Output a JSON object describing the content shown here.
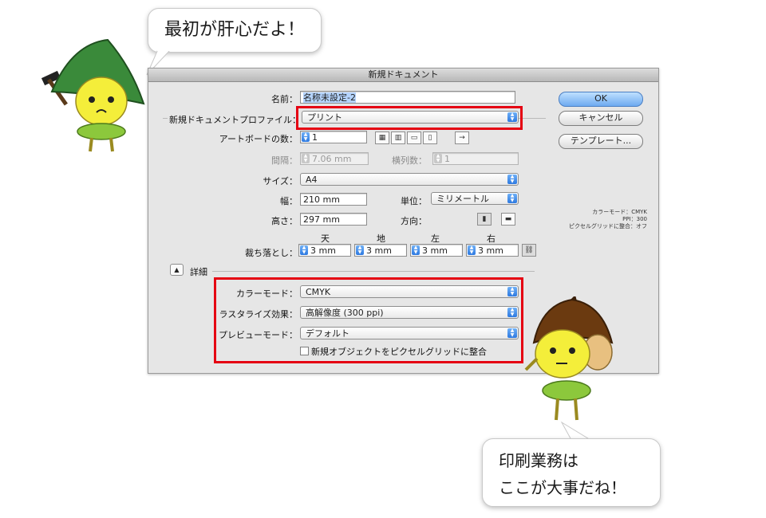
{
  "bubble_top": "最初が肝心だよ！",
  "bubble_bottom": [
    "印刷業務は",
    "ここが大事だね！"
  ],
  "dialog": {
    "title": "新規ドキュメント",
    "name_label": "名前：",
    "name_value": "名称未設定-2",
    "profile_label": "新規ドキュメントプロファイル：",
    "profile_value": "プリント",
    "artboards_label": "アートボードの数：",
    "artboards_value": "1",
    "spacing_label": "間隔：",
    "spacing_value": "7.06 mm",
    "columns_label": "横列数：",
    "columns_value": "1",
    "size_label": "サイズ：",
    "size_value": "A4",
    "width_label": "幅：",
    "width_value": "210 mm",
    "units_label": "単位：",
    "units_value": "ミリメートル",
    "height_label": "高さ：",
    "height_value": "297 mm",
    "orientation_label": "方向：",
    "bleed_label": "裁ち落とし：",
    "bleed_headers": [
      "天",
      "地",
      "左",
      "右"
    ],
    "bleed_values": [
      "3 mm",
      "3 mm",
      "3 mm",
      "3 mm"
    ],
    "advanced_label": "詳細",
    "color_mode_label": "カラーモード：",
    "color_mode_value": "CMYK",
    "raster_label": "ラスタライズ効果：",
    "raster_value": "高解像度 (300 ppi)",
    "preview_label": "プレビューモード：",
    "preview_value": "デフォルト",
    "align_pixel_label": "新規オブジェクトをピクセルグリッドに整合",
    "buttons": {
      "ok": "OK",
      "cancel": "キャンセル",
      "templates": "テンプレート..."
    },
    "summary": [
      "カラーモード：CMYK",
      "PPI：300",
      "ピクセルグリッドに整合：オフ"
    ]
  },
  "colors": {
    "highlight_frame": "#e50012",
    "accent": "#2d79e0"
  }
}
